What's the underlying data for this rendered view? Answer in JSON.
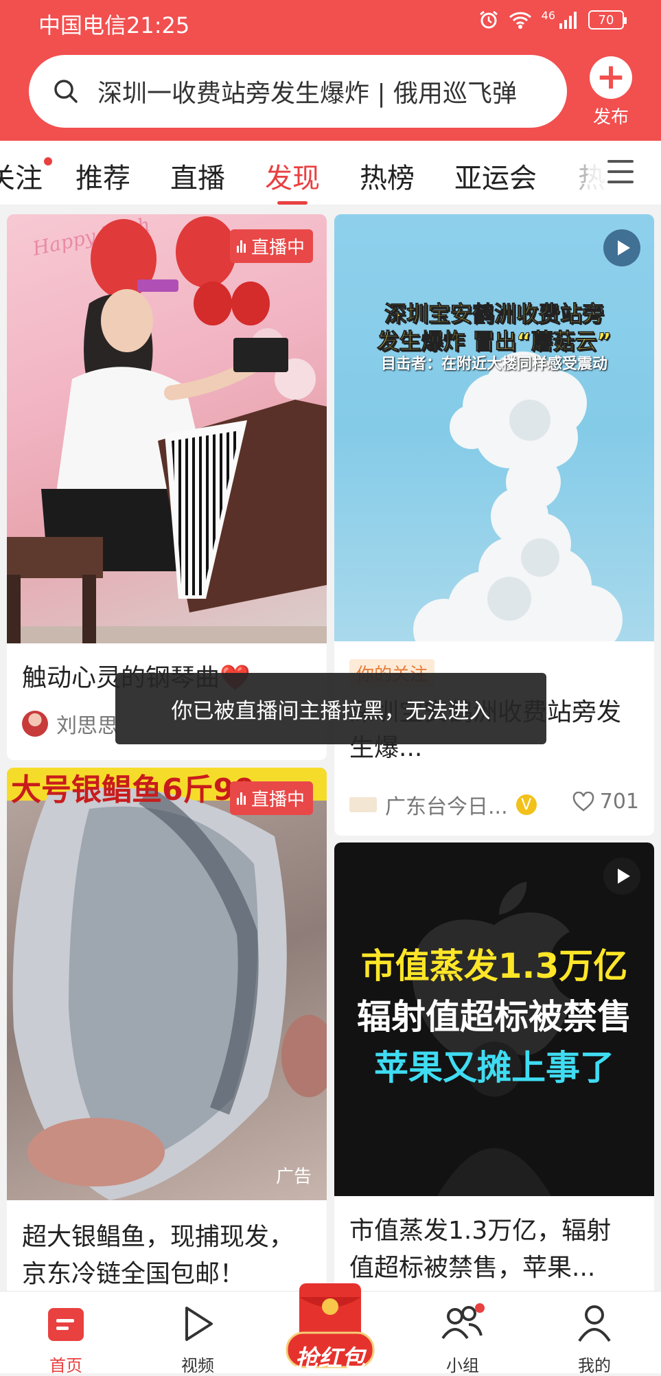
{
  "status_bar": {
    "carrier_time": "中国电信21:25",
    "network": "46",
    "battery": "70"
  },
  "search": {
    "placeholder": "深圳一收费站旁发生爆炸 | 俄用巡飞弹"
  },
  "publish": {
    "label": "发布"
  },
  "tabs": [
    {
      "label": "关注",
      "has_dot": true
    },
    {
      "label": "推荐"
    },
    {
      "label": "直播"
    },
    {
      "label": "发现",
      "active": true
    },
    {
      "label": "热榜"
    },
    {
      "label": "亚运会"
    },
    {
      "label": "热"
    }
  ],
  "cards": {
    "piano": {
      "title": "触动心灵的钢琴曲❤️",
      "author": "刘思思",
      "badge": "直播中",
      "banner_text": "Happy Birth"
    },
    "explosion": {
      "headline_1": "深圳宝安鹤洲收费站旁",
      "headline_2": "发生爆炸 冒出“蘑菇云”",
      "subline": "目击者：在附近大楼同样感受震动",
      "tag": "你的关注",
      "title": "深圳宝安鹤洲收费站旁发生爆...",
      "title_visible_part": "圳宝安",
      "source": "广东台今日...",
      "likes": "701"
    },
    "fish": {
      "banner": "大号银鲳鱼6斤99",
      "badge": "直播中",
      "ad": "广告",
      "title_line1": "超大银鲳鱼，现捕现发，",
      "title_line2": "京东冷链全国包邮！"
    },
    "apple": {
      "line1": "市值蒸发1.3万亿",
      "line2": "辐射值超标被禁售",
      "line3": "苹果又摊上事了",
      "title_line1": "市值蒸发1.3万亿，辐射",
      "title_line2": "值超标被禁售，苹果..."
    }
  },
  "toast": {
    "message": "你已被直播间主播拉黑，无法进入"
  },
  "bottom_nav": {
    "home": "首页",
    "video": "视频",
    "hongbao": "抢红包",
    "group": "小组",
    "me": "我的"
  },
  "colors": {
    "brand_red": "#f24f4f",
    "accent_red": "#e94040"
  }
}
